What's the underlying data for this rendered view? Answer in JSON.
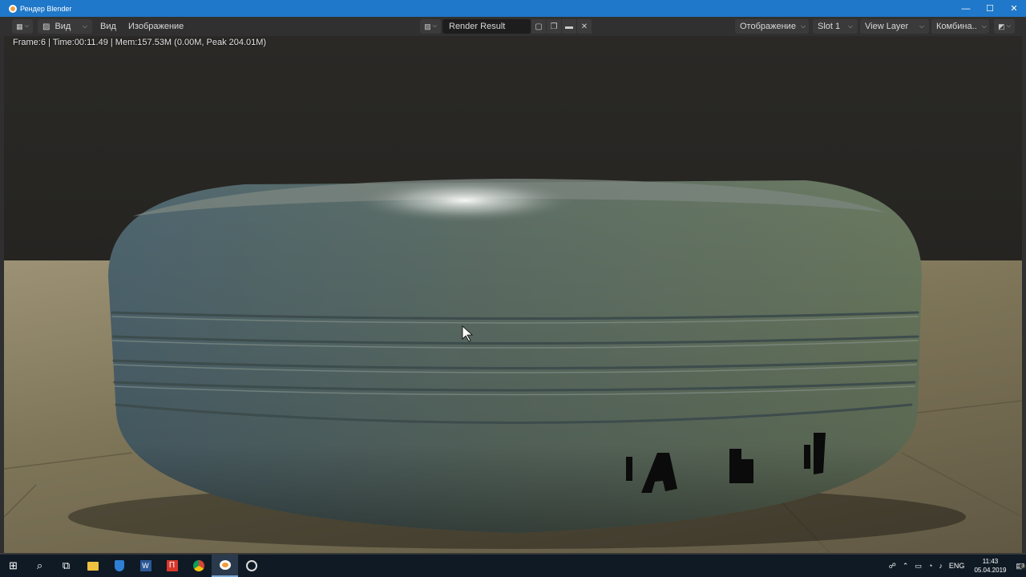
{
  "window": {
    "title": "Рендер Blender",
    "controls": {
      "minimize": "—",
      "maximize": "☐",
      "close": "✕"
    }
  },
  "header": {
    "view_type_icon": "image-editor-icon",
    "view_dropdown": "Вид",
    "menu_view": "Вид",
    "menu_image": "Изображение",
    "image_name": "Render Result",
    "display_dropdown": "Отображение",
    "slot_dropdown": "Slot 1",
    "layer_dropdown": "View Layer",
    "pass_dropdown": "Комбина..",
    "chevron": "⌵"
  },
  "viewport": {
    "stats": "Frame:6 | Time:00:11.49 | Mem:157.53M (0.00M, Peak 204.01M)"
  },
  "taskbar": {
    "lang": "ENG",
    "time": "11:43",
    "date": "05.04.2019",
    "notifications": "3"
  },
  "colors": {
    "titlebar": "#1f78c9",
    "header": "#303030",
    "tire": "#5b6f6b",
    "taskbar": "#0f1a24"
  }
}
